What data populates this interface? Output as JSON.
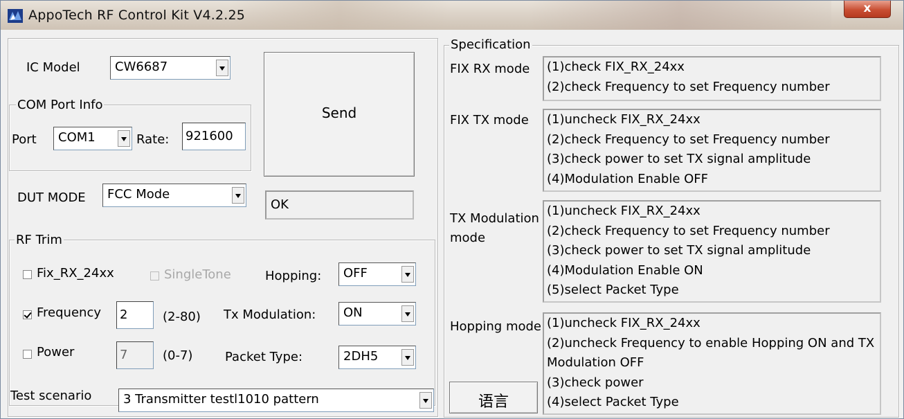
{
  "window": {
    "title": "AppoTech RF Control Kit V4.2.25",
    "close_label": "x",
    "accent": "#c94f33"
  },
  "ic_model": {
    "label": "IC Model",
    "value": "CW6687"
  },
  "com_port": {
    "group_title": "COM Port Info",
    "port_label": "Port",
    "port_value": "COM1",
    "rate_label": "Rate:",
    "rate_value": "921600"
  },
  "send_button": "Send",
  "dut_mode": {
    "label": "DUT MODE",
    "value": "FCC Mode"
  },
  "status_text": "OK",
  "rf_trim": {
    "group_title": "RF Trim",
    "fix_rx": {
      "label": "Fix_RX_24xx",
      "checked": false
    },
    "single_tone": {
      "label": "SingleTone",
      "checked": false,
      "enabled": false
    },
    "hopping": {
      "label": "Hopping:",
      "value": "OFF"
    },
    "frequency": {
      "label": "Frequency",
      "checked": true,
      "value": "2",
      "range": "(2-80)"
    },
    "tx_modulation": {
      "label": "Tx Modulation:",
      "value": "ON"
    },
    "power": {
      "label": "Power",
      "checked": false,
      "value": "7",
      "range": "(0-7)"
    },
    "packet_type": {
      "label": "Packet Type:",
      "value": "2DH5"
    }
  },
  "test_scenario": {
    "label": "Test scenario",
    "value": "3 Transmitter testl1010 pattern"
  },
  "specification": {
    "group_title": "Specification",
    "fix_rx_mode": {
      "label": "FIX RX mode",
      "lines": [
        "(1)check FIX_RX_24xx",
        "(2)check Frequency to set Frequency number"
      ]
    },
    "fix_tx_mode": {
      "label": "FIX TX mode",
      "lines": [
        "(1)uncheck FIX_RX_24xx",
        "(2)check Frequency to set Frequency number",
        "(3)check power to set TX signal amplitude",
        "(4)Modulation Enable OFF"
      ]
    },
    "tx_mod_mode": {
      "label_line1": "TX Modulation",
      "label_line2": "mode",
      "lines": [
        "(1)uncheck FIX_RX_24xx",
        "(2)check Frequency to set Frequency number",
        "(3)check power to set TX signal amplitude",
        "(4)Modulation Enable ON",
        "(5)select Packet Type"
      ]
    },
    "hopping_mode": {
      "label": "Hopping mode",
      "lines": [
        "(1)uncheck FIX_RX_24xx",
        "(2)uncheck Frequency to enable Hopping ON and TX",
        "Modulation OFF",
        "(3)check power",
        "(4)select Packet Type"
      ]
    }
  },
  "language_button": "语言"
}
